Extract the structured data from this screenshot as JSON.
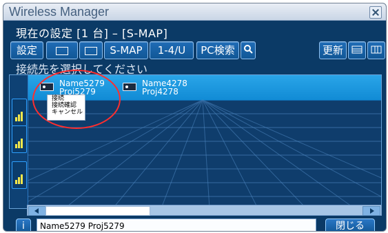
{
  "window": {
    "title": "Wireless Manager",
    "status": "現在の設定 [1 台] – [S-MAP]",
    "prompt": "接続先を選択してください"
  },
  "toolbar": {
    "settings_label": "設定",
    "smap_label": "S-MAP",
    "mode_label": "1-4/U",
    "pc_search_label": "PC検索",
    "refresh_label": "更新"
  },
  "projectors": [
    {
      "name": "Name5279",
      "proj": "Proj5279"
    },
    {
      "name": "Name4278",
      "proj": "Proj4278"
    }
  ],
  "context_menu": {
    "items": [
      "接続",
      "接続確認",
      "キャンセル"
    ]
  },
  "footer": {
    "info_text": "Name5279 Proj5279",
    "close_label": "閉じる",
    "info_icon": "i"
  }
}
